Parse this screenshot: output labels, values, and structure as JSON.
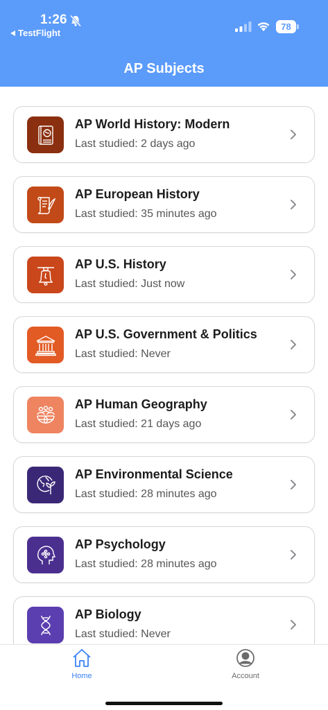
{
  "status_bar": {
    "time": "1:26",
    "back_app": "TestFlight",
    "battery": "78"
  },
  "nav": {
    "title": "AP Subjects"
  },
  "subjects": [
    {
      "title": "AP World History: Modern",
      "last_studied": "Last studied: 2 days ago",
      "icon": "history-book-icon",
      "color": "#8a2f0f"
    },
    {
      "title": "AP European History",
      "last_studied": "Last studied: 35 minutes ago",
      "icon": "scroll-quill-icon",
      "color": "#c24a18"
    },
    {
      "title": "AP U.S. History",
      "last_studied": "Last studied: Just now",
      "icon": "liberty-bell-icon",
      "color": "#c9471b"
    },
    {
      "title": "AP U.S. Government & Politics",
      "last_studied": "Last studied: Never",
      "icon": "capitol-building-icon",
      "color": "#e25a24"
    },
    {
      "title": "AP Human Geography",
      "last_studied": "Last studied: 21 days ago",
      "icon": "people-globe-icon",
      "color": "#ee8460"
    },
    {
      "title": "AP Environmental Science",
      "last_studied": "Last studied: 28 minutes ago",
      "icon": "earth-plant-icon",
      "color": "#3a2877"
    },
    {
      "title": "AP Psychology",
      "last_studied": "Last studied: 28 minutes ago",
      "icon": "brain-head-icon",
      "color": "#4b2f8f"
    },
    {
      "title": "AP Biology",
      "last_studied": "Last studied: Never",
      "icon": "dna-icon",
      "color": "#5b3eb0"
    }
  ],
  "tabbar": {
    "home_label": "Home",
    "account_label": "Account",
    "active_color": "#3b82f6"
  }
}
